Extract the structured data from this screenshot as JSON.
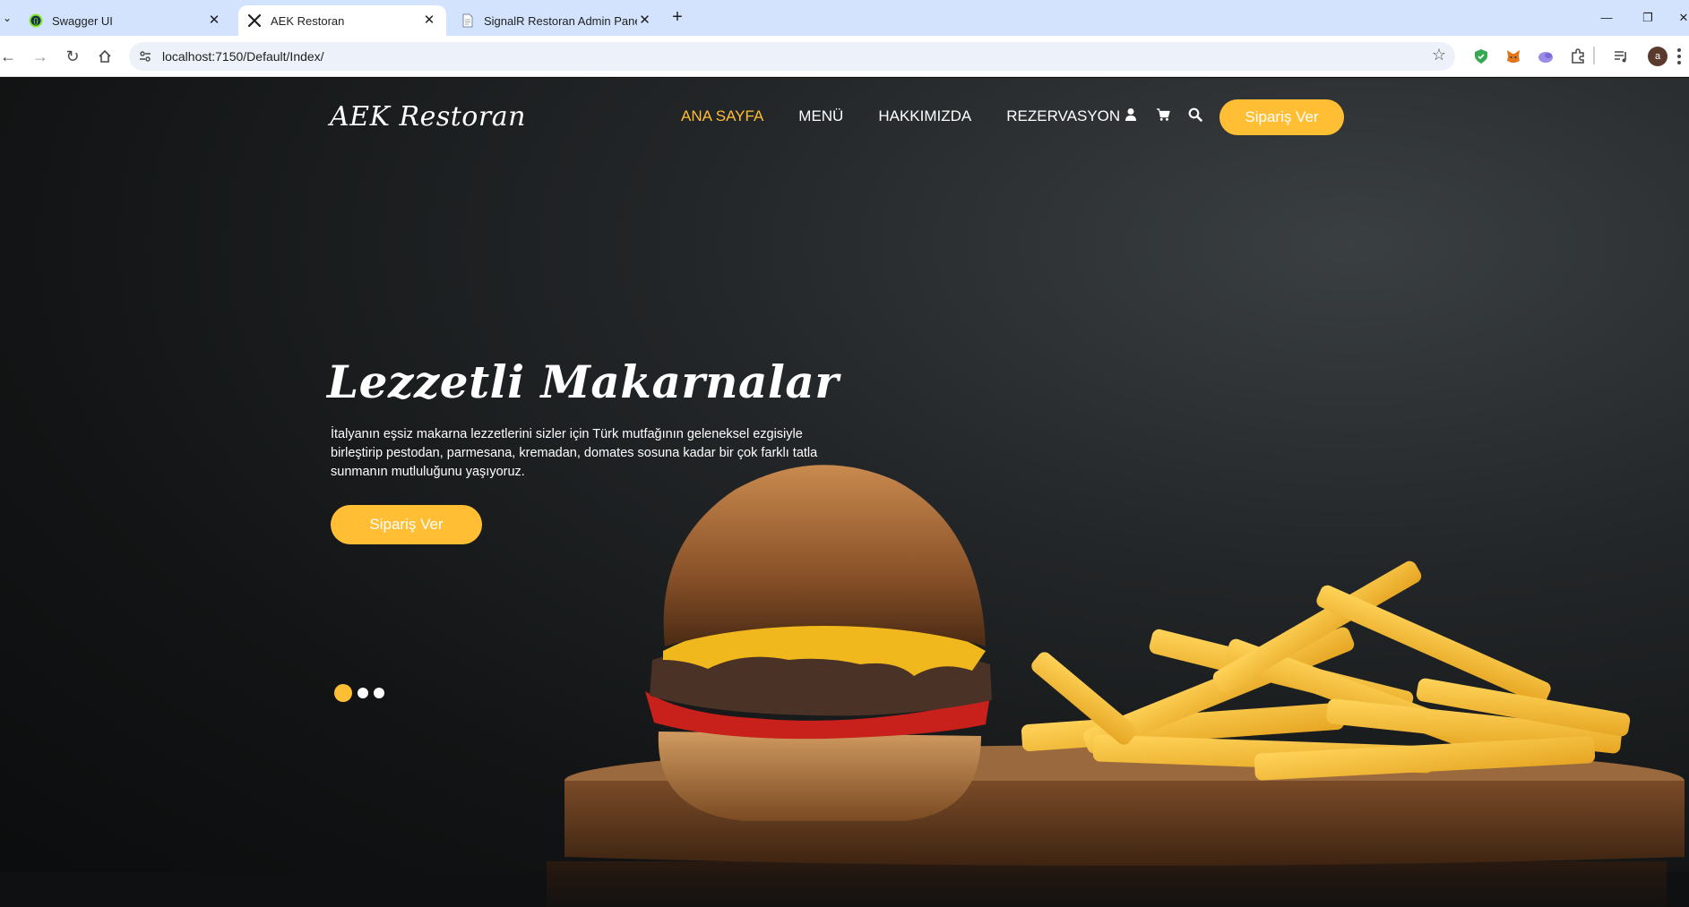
{
  "browser": {
    "tabs": [
      {
        "title": "Swagger UI",
        "favicon": "swagger-icon",
        "active": false
      },
      {
        "title": "AEK Restoran",
        "favicon": "utensils-icon",
        "active": true
      },
      {
        "title": "SignalR Restoran Admin Paneli",
        "favicon": "page-icon",
        "active": false
      }
    ],
    "url": "localhost:7150/Default/Index/",
    "avatar_letter": "a"
  },
  "header": {
    "brand": "AEK Restoran",
    "nav": [
      {
        "label": "ANA SAYFA",
        "active": true
      },
      {
        "label": "MENÜ",
        "active": false
      },
      {
        "label": "HAKKIMIZDA",
        "active": false
      },
      {
        "label": "REZERVASYON",
        "active": false
      }
    ],
    "icons": [
      "user-icon",
      "cart-icon",
      "search-icon"
    ],
    "order_button": "Sipariş Ver"
  },
  "hero": {
    "title": "Lezzetli Makarnalar",
    "text": "İtalyanın eşsiz makarna lezzetlerini sizler için Türk mutfağının geleneksel ezgisiyle birleştirip pestodan, parmesana, kremadan, domates sosuna kadar bir çok farklı tatla sunmanın mutluluğunu yaşıyoruz.",
    "button": "Sipariş Ver",
    "slides_total": 3,
    "slide_active": 1
  },
  "colors": {
    "accent": "#ffbe33",
    "tabstrip": "#d3e3fd"
  }
}
